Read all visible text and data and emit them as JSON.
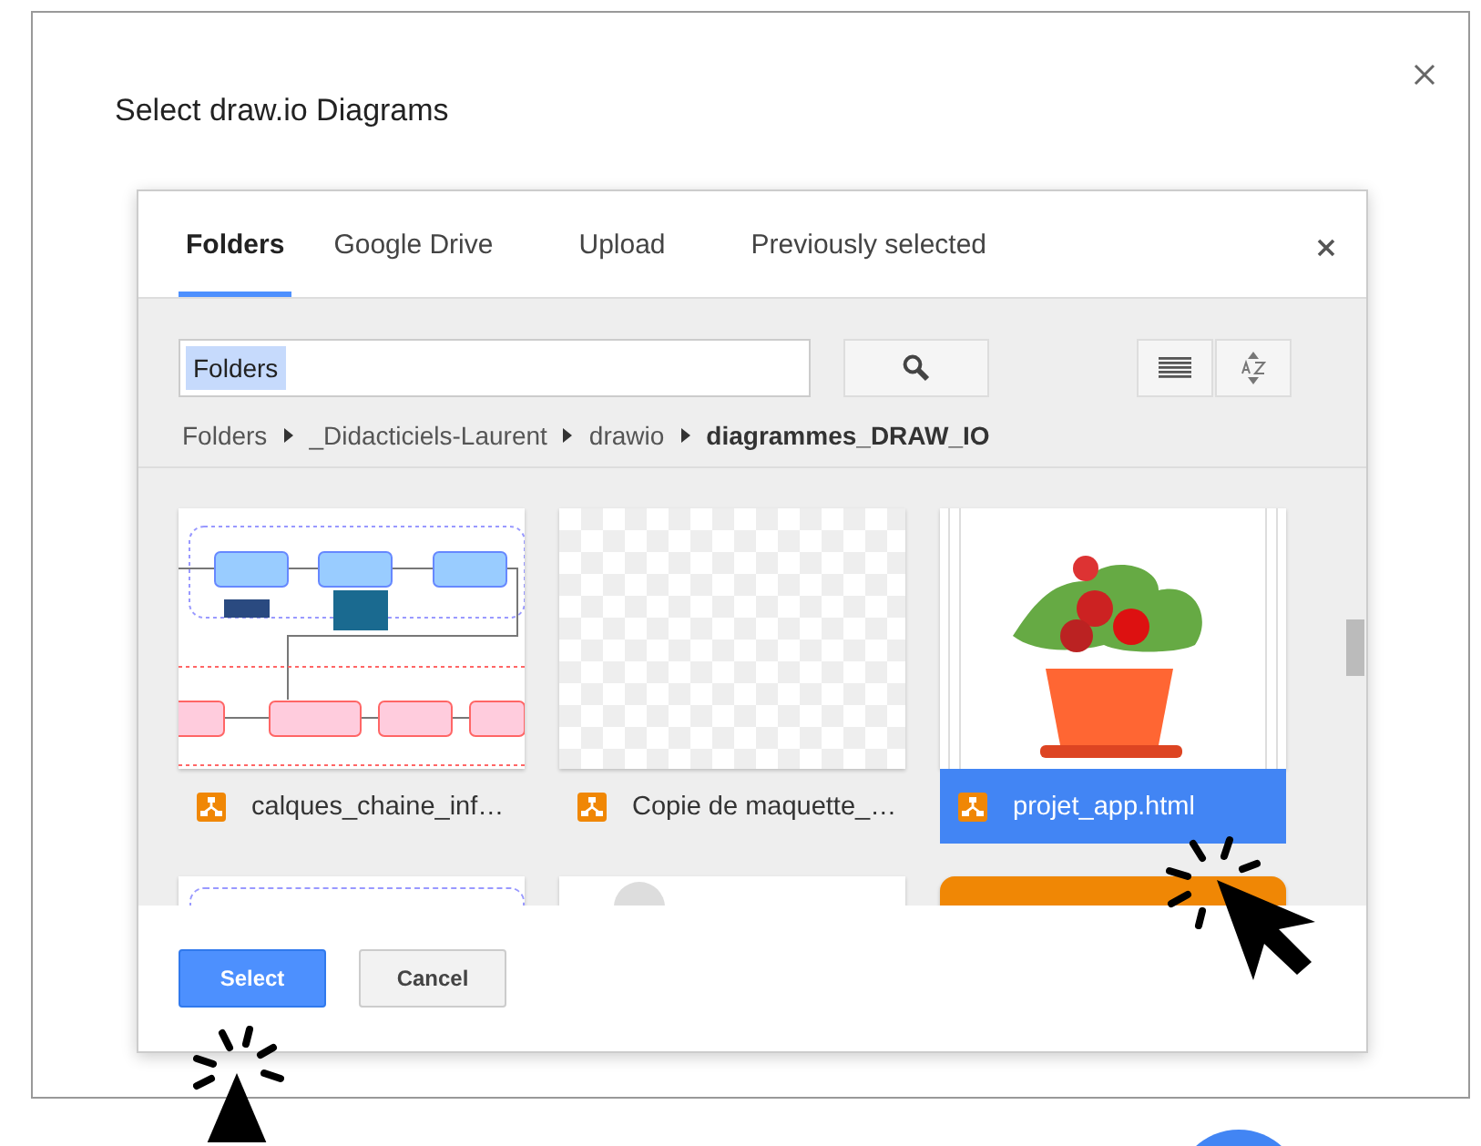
{
  "dialog": {
    "title": "Select draw.io Diagrams"
  },
  "tabs": [
    {
      "label": "Folders",
      "selected": true
    },
    {
      "label": "Google Drive",
      "selected": false
    },
    {
      "label": "Upload",
      "selected": false
    },
    {
      "label": "Previously selected",
      "selected": false
    }
  ],
  "search": {
    "value": "Folders"
  },
  "breadcrumb": [
    {
      "label": "Folders",
      "current": false
    },
    {
      "label": "_Didacticiels-Laurent",
      "current": false
    },
    {
      "label": "drawio",
      "current": false
    },
    {
      "label": "diagrammes_DRAW_IO",
      "current": true
    }
  ],
  "files": [
    {
      "name": "calques_chaine_inf…",
      "kind": "diagram",
      "selected": false
    },
    {
      "name": "Copie de maquette_…",
      "kind": "blank",
      "selected": false
    },
    {
      "name": "projet_app.html",
      "kind": "plant",
      "selected": true
    }
  ],
  "more_files": [
    {
      "kind": "diagram"
    },
    {
      "kind": "round"
    },
    {
      "kind": "orange"
    }
  ],
  "buttons": [
    {
      "label": "Select",
      "kind": "primary"
    },
    {
      "label": "Cancel",
      "kind": "secondary"
    }
  ]
}
